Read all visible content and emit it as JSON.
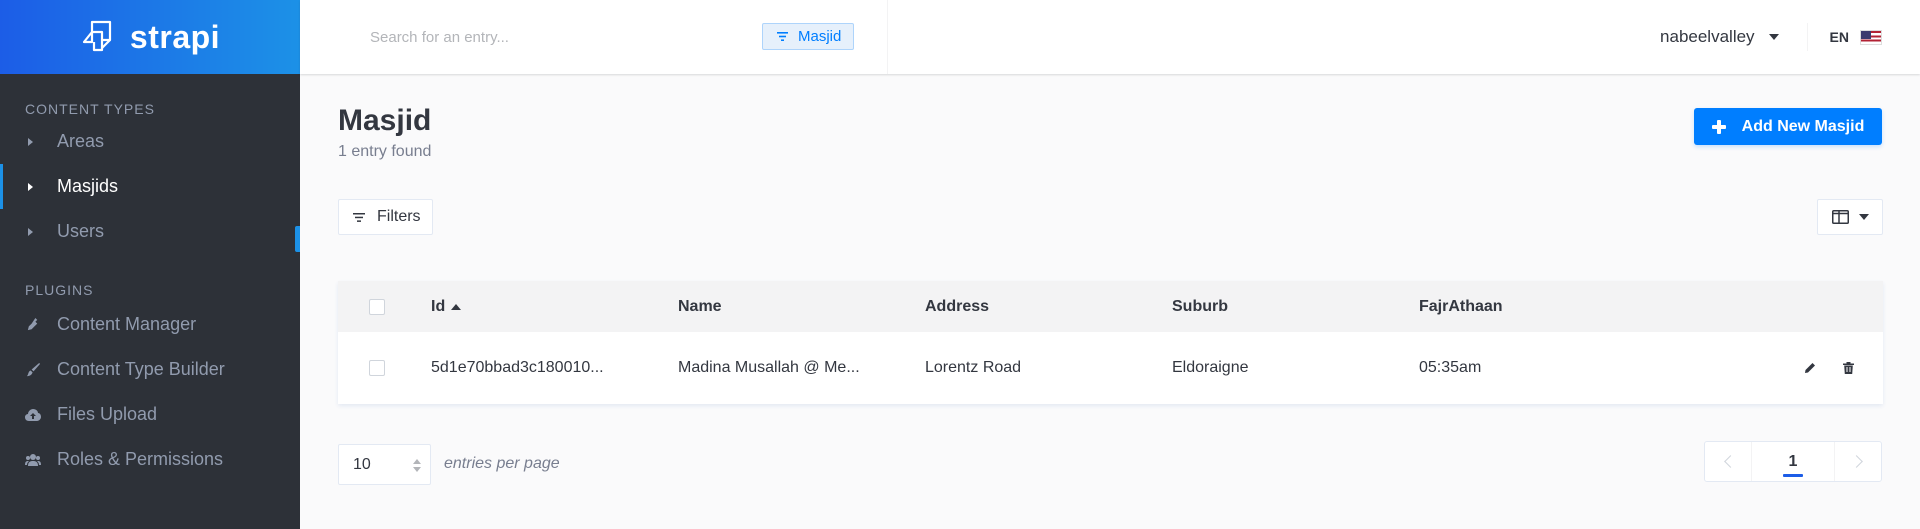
{
  "brand": {
    "name": "strapi"
  },
  "sidebar": {
    "content_types_title": "CONTENT TYPES",
    "content_types": [
      {
        "label": "Areas",
        "active": false
      },
      {
        "label": "Masjids",
        "active": true
      },
      {
        "label": "Users",
        "active": false
      }
    ],
    "plugins_title": "PLUGINS",
    "plugins": [
      {
        "label": "Content Manager",
        "icon": "plug-icon"
      },
      {
        "label": "Content Type Builder",
        "icon": "paint-brush-icon"
      },
      {
        "label": "Files Upload",
        "icon": "cloud-upload-icon"
      },
      {
        "label": "Roles & Permissions",
        "icon": "users-icon"
      }
    ]
  },
  "header": {
    "search_placeholder": "Search for an entry...",
    "search_filter": "Masjid",
    "username": "nabeelvalley",
    "language": "EN"
  },
  "page": {
    "title": "Masjid",
    "subtitle": "1 entry found",
    "add_button": "Add New Masjid",
    "filters_button": "Filters"
  },
  "table": {
    "columns": [
      "Id",
      "Name",
      "Address",
      "Suburb",
      "FajrAthaan"
    ],
    "sorted_column": "Id",
    "rows": [
      {
        "id": "5d1e70bbad3c180010...",
        "name": "Madina Musallah @ Me...",
        "address": "Lorentz Road",
        "suburb": "Eldoraigne",
        "fajr": "05:35am"
      }
    ]
  },
  "pagination": {
    "per_page": "10",
    "per_page_label": "entries per page",
    "current_page": "1"
  },
  "colors": {
    "accent": "#007eff",
    "sidebar_bg": "#2d3138",
    "brand_gradient_start": "#1c5de7",
    "brand_gradient_end": "#1c91e7"
  }
}
